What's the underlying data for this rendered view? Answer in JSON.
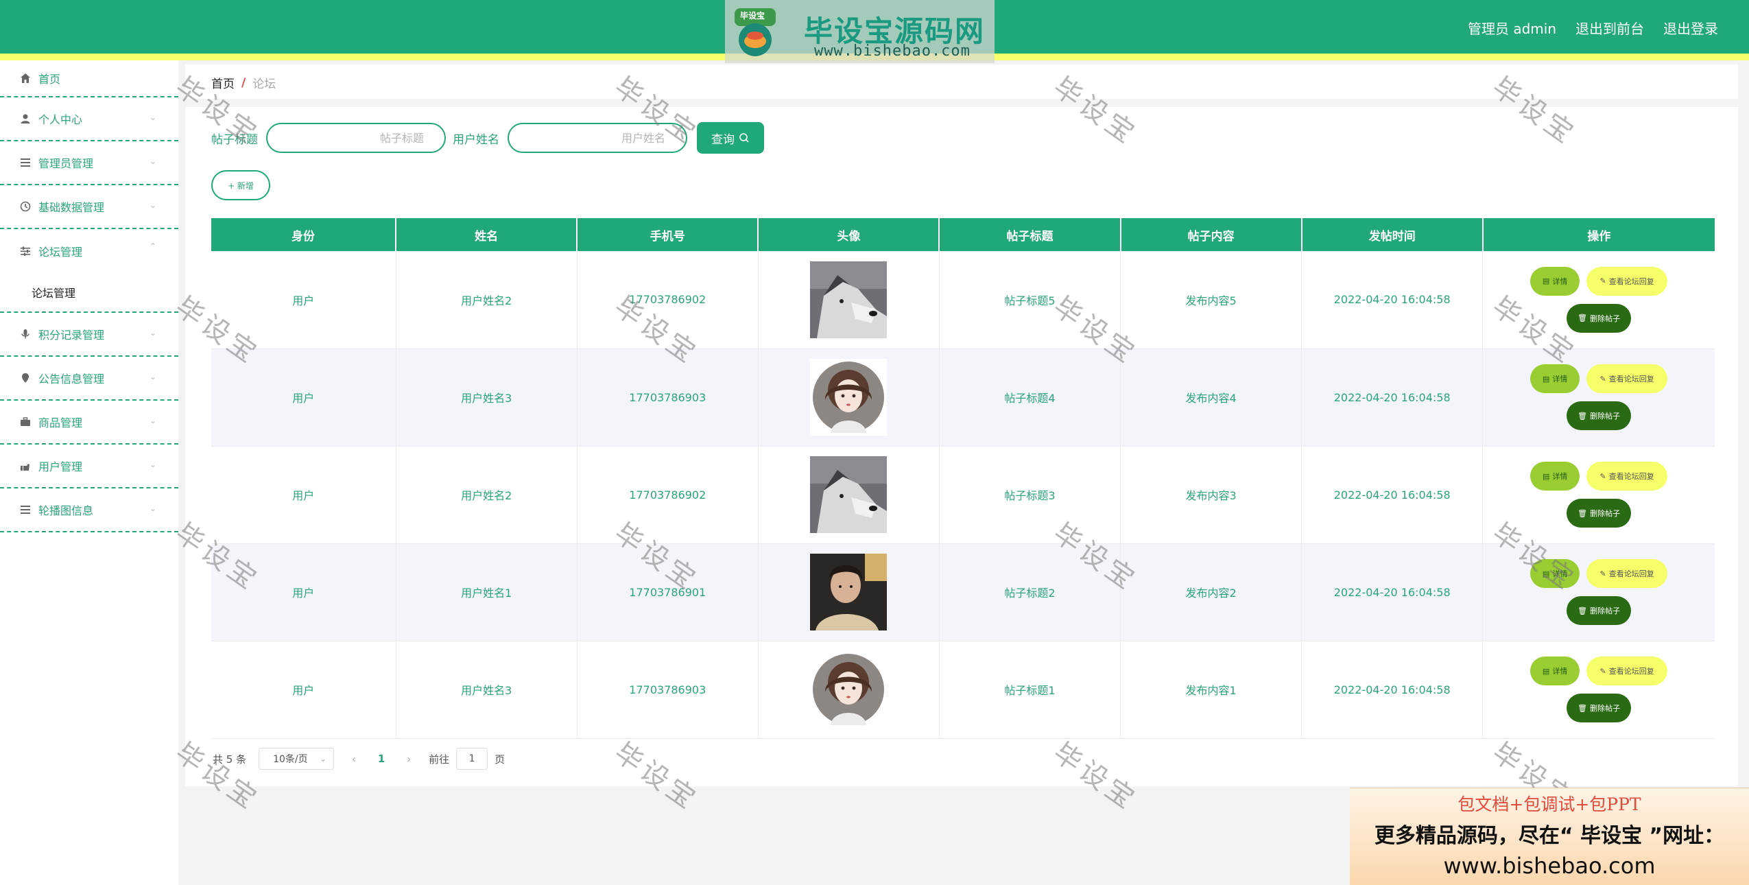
{
  "header": {
    "logo_badge": "毕设宝",
    "logo_title": "毕设宝源码网",
    "logo_url": "www.bishebao.com",
    "admin_label": "管理员 admin",
    "front_link": "退出到前台",
    "logout_link": "退出登录"
  },
  "sidebar": {
    "home": "首页",
    "items": [
      {
        "label": "个人中心",
        "icon": "user-icon"
      },
      {
        "label": "管理员管理",
        "icon": "list-icon"
      },
      {
        "label": "基础数据管理",
        "icon": "clock-icon"
      },
      {
        "label": "论坛管理",
        "icon": "sliders-icon",
        "open": true,
        "sub": "论坛管理"
      },
      {
        "label": "积分记录管理",
        "icon": "mic-icon"
      },
      {
        "label": "公告信息管理",
        "icon": "pin-icon"
      },
      {
        "label": "商品管理",
        "icon": "briefcase-icon"
      },
      {
        "label": "用户管理",
        "icon": "hand-icon"
      },
      {
        "label": "轮播图信息",
        "icon": "list-icon"
      }
    ]
  },
  "breadcrumb": {
    "home": "首页",
    "sep": "/",
    "current": "论坛"
  },
  "search": {
    "title_label": "帖子标题",
    "title_placeholder": "帖子标题",
    "name_label": "用户姓名",
    "name_placeholder": "用户姓名",
    "query_label": "查询"
  },
  "add_label": "+ 新增",
  "table": {
    "headers": [
      "身份",
      "姓名",
      "手机号",
      "头像",
      "帖子标题",
      "帖子内容",
      "发帖时间",
      "操作"
    ],
    "rows": [
      {
        "role": "用户",
        "name": "用户姓名2",
        "phone": "17703786902",
        "avatar": "husky",
        "title": "帖子标题5",
        "content": "发布内容5",
        "time": "2022-04-20 16:04:58"
      },
      {
        "role": "用户",
        "name": "用户姓名3",
        "phone": "17703786903",
        "avatar": "girl",
        "title": "帖子标题4",
        "content": "发布内容4",
        "time": "2022-04-20 16:04:58"
      },
      {
        "role": "用户",
        "name": "用户姓名2",
        "phone": "17703786902",
        "avatar": "husky",
        "title": "帖子标题3",
        "content": "发布内容3",
        "time": "2022-04-20 16:04:58"
      },
      {
        "role": "用户",
        "name": "用户姓名1",
        "phone": "17703786901",
        "avatar": "man",
        "title": "帖子标题2",
        "content": "发布内容2",
        "time": "2022-04-20 16:04:58"
      },
      {
        "role": "用户",
        "name": "用户姓名3",
        "phone": "17703786903",
        "avatar": "girl",
        "title": "帖子标题1",
        "content": "发布内容1",
        "time": "2022-04-20 16:04:58"
      }
    ],
    "ops": {
      "detail": "详情",
      "reply": "查看论坛回复",
      "delete": "删除帖子"
    }
  },
  "pagination": {
    "total": "共 5 条",
    "page_size": "10条/页",
    "current_page": "1",
    "goto_prefix": "前往",
    "goto_value": "1",
    "goto_suffix": "页"
  },
  "watermark": "毕设宝",
  "ad": {
    "line1": "包文档+包调试+包PPT",
    "line2": "更多精品源码，尽在“ 毕设宝 ”网址：",
    "line3": "www.bishebao.com"
  },
  "colors": {
    "primary": "#21a878",
    "accent_yellow": "#f5ff6a",
    "detail_btn": "#9acd32",
    "delete_btn": "#2a6a14"
  }
}
